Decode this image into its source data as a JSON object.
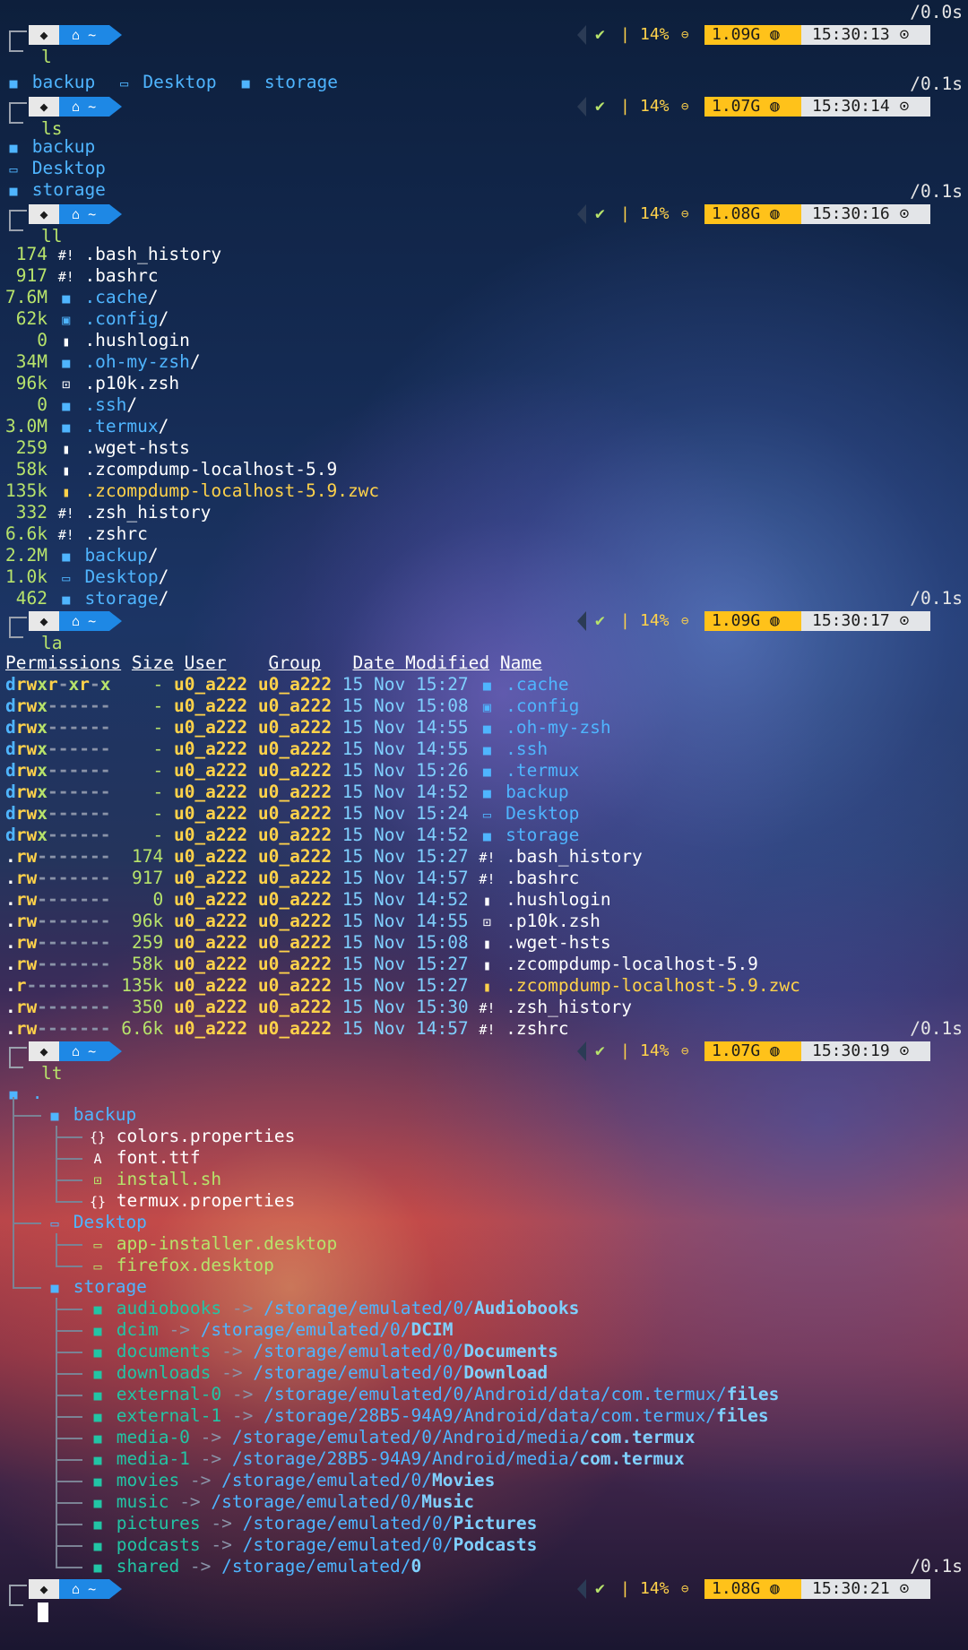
{
  "prompt": {
    "os_icon": "android-icon",
    "dir_icon": "home-icon",
    "dir": "~",
    "battery": "14%",
    "lock_icon": "lock-icon",
    "check": "✔",
    "sep": "|",
    "clock_icon": "clock-icon",
    "mem_icon": "ram-icon"
  },
  "blocks": [
    {
      "duration": "/0.0s",
      "mem": "1.09G",
      "time": "15:30:13",
      "cmd": "l"
    },
    {
      "duration": "/0.1s",
      "mem": "1.07G",
      "time": "15:30:14",
      "cmd": "ls"
    },
    {
      "duration": "/0.1s",
      "mem": "1.08G",
      "time": "15:30:16",
      "cmd": "ll"
    },
    {
      "duration": "/0.1s",
      "mem": "1.09G",
      "time": "15:30:17",
      "cmd": "la"
    },
    {
      "duration": "/0.1s",
      "mem": "1.07G",
      "time": "15:30:19",
      "cmd": "lt"
    },
    {
      "duration": "/0.1s",
      "mem": "1.08G",
      "time": "15:30:21",
      "cmd": ""
    }
  ],
  "l_output": [
    "backup",
    "Desktop",
    "storage"
  ],
  "ls_output": [
    "backup",
    "Desktop",
    "storage"
  ],
  "ll_output": [
    {
      "size": "174",
      "name": ".bash_history",
      "kind": "hash"
    },
    {
      "size": "917",
      "name": ".bashrc",
      "kind": "hash"
    },
    {
      "size": "7.6M",
      "name": ".cache",
      "kind": "dir"
    },
    {
      "size": "62k",
      "name": ".config",
      "kind": "cfgdir"
    },
    {
      "size": "0",
      "name": ".hushlogin",
      "kind": "file"
    },
    {
      "size": "34M",
      "name": ".oh-my-zsh",
      "kind": "dir"
    },
    {
      "size": "96k",
      "name": ".p10k.zsh",
      "kind": "script"
    },
    {
      "size": "0",
      "name": ".ssh",
      "kind": "dir"
    },
    {
      "size": "3.0M",
      "name": ".termux",
      "kind": "dir"
    },
    {
      "size": "259",
      "name": ".wget-hsts",
      "kind": "file"
    },
    {
      "size": "58k",
      "name": ".zcompdump-localhost-5.9",
      "kind": "file"
    },
    {
      "size": "135k",
      "name": ".zcompdump-localhost-5.9.zwc",
      "kind": "yfile"
    },
    {
      "size": "332",
      "name": ".zsh_history",
      "kind": "hash"
    },
    {
      "size": "6.6k",
      "name": ".zshrc",
      "kind": "hash"
    },
    {
      "size": "2.2M",
      "name": "backup",
      "kind": "dir"
    },
    {
      "size": "1.0k",
      "name": "Desktop",
      "kind": "desk"
    },
    {
      "size": "462",
      "name": "storage",
      "kind": "dir"
    }
  ],
  "la_headers": {
    "perm": "Permissions",
    "size": "Size",
    "user": "User",
    "group": "Group",
    "date": "Date Modified",
    "name": "Name"
  },
  "la_rows": [
    {
      "perm": "drwxr-xr-x",
      "size": "-",
      "user": "u0_a222",
      "group": "u0_a222",
      "date": "15 Nov 15:27",
      "name": ".cache",
      "kind": "dir"
    },
    {
      "perm": "drwx------",
      "size": "-",
      "user": "u0_a222",
      "group": "u0_a222",
      "date": "15 Nov 15:08",
      "name": ".config",
      "kind": "cfgdir"
    },
    {
      "perm": "drwx------",
      "size": "-",
      "user": "u0_a222",
      "group": "u0_a222",
      "date": "15 Nov 14:55",
      "name": ".oh-my-zsh",
      "kind": "dir"
    },
    {
      "perm": "drwx------",
      "size": "-",
      "user": "u0_a222",
      "group": "u0_a222",
      "date": "15 Nov 14:55",
      "name": ".ssh",
      "kind": "dir"
    },
    {
      "perm": "drwx------",
      "size": "-",
      "user": "u0_a222",
      "group": "u0_a222",
      "date": "15 Nov 15:26",
      "name": ".termux",
      "kind": "dir"
    },
    {
      "perm": "drwx------",
      "size": "-",
      "user": "u0_a222",
      "group": "u0_a222",
      "date": "15 Nov 14:52",
      "name": "backup",
      "kind": "dir"
    },
    {
      "perm": "drwx------",
      "size": "-",
      "user": "u0_a222",
      "group": "u0_a222",
      "date": "15 Nov 15:24",
      "name": "Desktop",
      "kind": "desk"
    },
    {
      "perm": "drwx------",
      "size": "-",
      "user": "u0_a222",
      "group": "u0_a222",
      "date": "15 Nov 14:52",
      "name": "storage",
      "kind": "dir"
    },
    {
      "perm": ".rw-------",
      "size": "174",
      "user": "u0_a222",
      "group": "u0_a222",
      "date": "15 Nov 15:27",
      "name": ".bash_history",
      "kind": "hash"
    },
    {
      "perm": ".rw-------",
      "size": "917",
      "user": "u0_a222",
      "group": "u0_a222",
      "date": "15 Nov 14:57",
      "name": ".bashrc",
      "kind": "hash"
    },
    {
      "perm": ".rw-------",
      "size": "0",
      "user": "u0_a222",
      "group": "u0_a222",
      "date": "15 Nov 14:52",
      "name": ".hushlogin",
      "kind": "file"
    },
    {
      "perm": ".rw-------",
      "size": "96k",
      "user": "u0_a222",
      "group": "u0_a222",
      "date": "15 Nov 14:55",
      "name": ".p10k.zsh",
      "kind": "script"
    },
    {
      "perm": ".rw-------",
      "size": "259",
      "user": "u0_a222",
      "group": "u0_a222",
      "date": "15 Nov 15:08",
      "name": ".wget-hsts",
      "kind": "file"
    },
    {
      "perm": ".rw-------",
      "size": "58k",
      "user": "u0_a222",
      "group": "u0_a222",
      "date": "15 Nov 15:27",
      "name": ".zcompdump-localhost-5.9",
      "kind": "file"
    },
    {
      "perm": ".r--------",
      "size": "135k",
      "user": "u0_a222",
      "group": "u0_a222",
      "date": "15 Nov 15:27",
      "name": ".zcompdump-localhost-5.9.zwc",
      "kind": "yfile"
    },
    {
      "perm": ".rw-------",
      "size": "350",
      "user": "u0_a222",
      "group": "u0_a222",
      "date": "15 Nov 15:30",
      "name": ".zsh_history",
      "kind": "hash"
    },
    {
      "perm": ".rw-------",
      "size": "6.6k",
      "user": "u0_a222",
      "group": "u0_a222",
      "date": "15 Nov 14:57",
      "name": ".zshrc",
      "kind": "hash"
    }
  ],
  "lt_tree": {
    "root": ".",
    "groups": [
      {
        "name": "backup",
        "kind": "dir",
        "children": [
          {
            "name": "colors.properties",
            "kind": "braces",
            "color": "white"
          },
          {
            "name": "font.ttf",
            "kind": "font",
            "color": "white"
          },
          {
            "name": "install.sh",
            "kind": "script",
            "color": "green"
          },
          {
            "name": "termux.properties",
            "kind": "braces",
            "color": "white"
          }
        ]
      },
      {
        "name": "Desktop",
        "kind": "desk",
        "children": [
          {
            "name": "app-installer.desktop",
            "kind": "desk",
            "color": "green"
          },
          {
            "name": "firefox.desktop",
            "kind": "desk",
            "color": "green"
          }
        ]
      },
      {
        "name": "storage",
        "kind": "dir",
        "children": [
          {
            "name": "audiobooks",
            "arrow": "->",
            "prefix": "/storage/emulated/0/",
            "target": "Audiobooks"
          },
          {
            "name": "dcim",
            "arrow": "->",
            "prefix": "/storage/emulated/0/",
            "target": "DCIM"
          },
          {
            "name": "documents",
            "arrow": "->",
            "prefix": "/storage/emulated/0/",
            "target": "Documents"
          },
          {
            "name": "downloads",
            "arrow": "->",
            "prefix": "/storage/emulated/0/",
            "target": "Download"
          },
          {
            "name": "external-0",
            "arrow": "->",
            "prefix": "/storage/emulated/0/Android/data/com.termux/",
            "target": "files"
          },
          {
            "name": "external-1",
            "arrow": "->",
            "prefix": "/storage/28B5-94A9/Android/data/com.termux/",
            "target": "files"
          },
          {
            "name": "media-0",
            "arrow": "->",
            "prefix": "/storage/emulated/0/Android/media/",
            "target": "com.termux"
          },
          {
            "name": "media-1",
            "arrow": "->",
            "prefix": "/storage/28B5-94A9/Android/media/",
            "target": "com.termux"
          },
          {
            "name": "movies",
            "arrow": "->",
            "prefix": "/storage/emulated/0/",
            "target": "Movies"
          },
          {
            "name": "music",
            "arrow": "->",
            "prefix": "/storage/emulated/0/",
            "target": "Music"
          },
          {
            "name": "pictures",
            "arrow": "->",
            "prefix": "/storage/emulated/0/",
            "target": "Pictures"
          },
          {
            "name": "podcasts",
            "arrow": "->",
            "prefix": "/storage/emulated/0/",
            "target": "Podcasts"
          },
          {
            "name": "shared",
            "arrow": "->",
            "prefix": "/storage/emulated/",
            "target": "0"
          }
        ]
      }
    ]
  }
}
